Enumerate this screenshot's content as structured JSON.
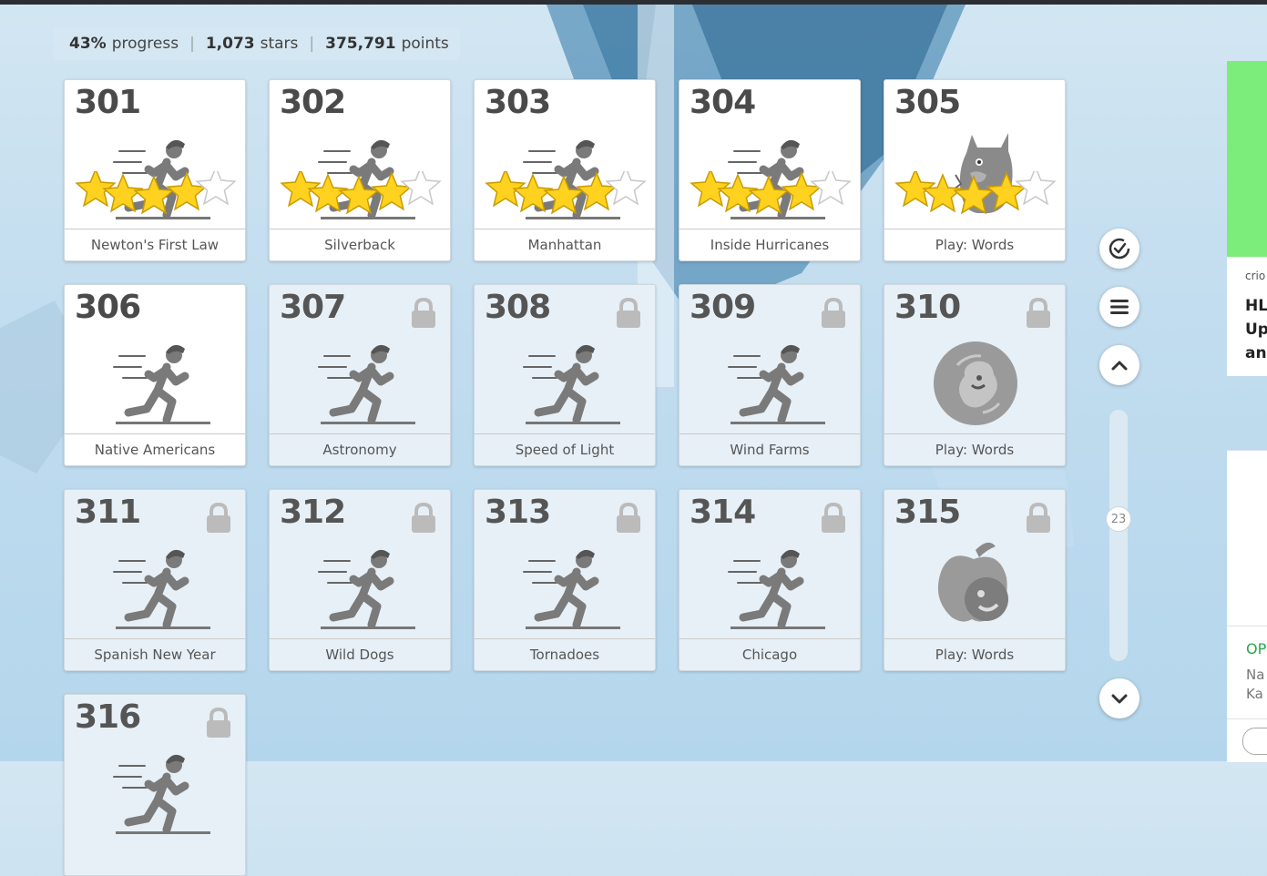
{
  "stats": {
    "progress_value": "43%",
    "progress_label": "progress",
    "stars_value": "1,073",
    "stars_label": "stars",
    "points_value": "375,791",
    "points_label": "points"
  },
  "tiles": [
    {
      "num": "301",
      "label": "Newton's First Law",
      "locked": false,
      "art": "runner",
      "stars": 4
    },
    {
      "num": "302",
      "label": "Silverback",
      "locked": false,
      "art": "runner",
      "stars": 4
    },
    {
      "num": "303",
      "label": "Manhattan",
      "locked": false,
      "art": "runner",
      "stars": 4
    },
    {
      "num": "304",
      "label": "Inside Hurricanes",
      "locked": false,
      "art": "runner",
      "stars": 4
    },
    {
      "num": "305",
      "label": "Play: Words",
      "locked": false,
      "art": "monster",
      "stars": 4
    },
    {
      "num": "306",
      "label": "Native Americans",
      "locked": false,
      "art": "runner",
      "stars": 0
    },
    {
      "num": "307",
      "label": "Astronomy",
      "locked": true,
      "art": "runner",
      "stars": 0
    },
    {
      "num": "308",
      "label": "Speed of Light",
      "locked": true,
      "art": "runner",
      "stars": 0
    },
    {
      "num": "309",
      "label": "Wind Farms",
      "locked": true,
      "art": "runner",
      "stars": 0
    },
    {
      "num": "310",
      "label": "Play: Words",
      "locked": true,
      "art": "badge",
      "stars": 0
    },
    {
      "num": "311",
      "label": "Spanish New Year",
      "locked": true,
      "art": "runner",
      "stars": 0
    },
    {
      "num": "312",
      "label": "Wild Dogs",
      "locked": true,
      "art": "runner",
      "stars": 0
    },
    {
      "num": "313",
      "label": "Tornadoes",
      "locked": true,
      "art": "runner",
      "stars": 0
    },
    {
      "num": "314",
      "label": "Chicago",
      "locked": true,
      "art": "runner",
      "stars": 0
    },
    {
      "num": "315",
      "label": "Play: Words",
      "locked": true,
      "art": "apple",
      "stars": 0
    },
    {
      "num": "316",
      "label": "",
      "locked": true,
      "art": "runner",
      "stars": 0
    }
  ],
  "controls": {
    "check_icon": "check-circle-icon",
    "menu_icon": "menu-icon",
    "up_icon": "chevron-up-icon",
    "down_icon": "chevron-down-icon",
    "page_indicator": "23"
  },
  "ads": {
    "ad1_small": "crio",
    "ad1_big": "HL\nUp\nan",
    "ad2_op": "OP",
    "ad2_sub": "Na\nKa"
  },
  "colors": {
    "star": "#ffd21f",
    "ad_green": "#7cec7a",
    "ad_text_green": "#2aa84a"
  }
}
